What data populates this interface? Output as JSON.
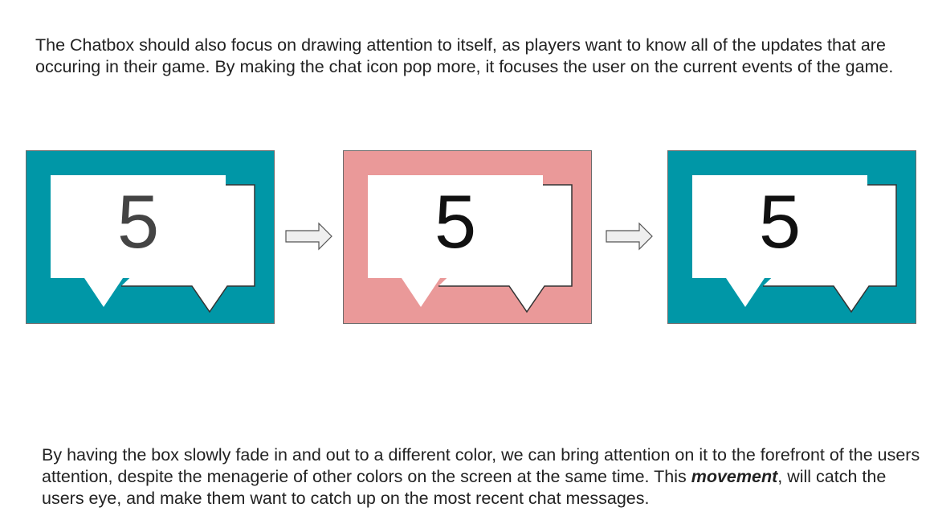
{
  "text": {
    "intro": "The Chatbox should also focus on drawing attention to itself, as players want to know all of the updates that are occuring in their game. By making the chat icon pop more, it focuses the user on the current events of the game.",
    "outro_before": "By having the box slowly fade in and out to a different color, we can bring attention on it to the forefront of the users attention, despite the menagerie of other colors on the screen at the same time. This ",
    "outro_emphasis": "movement",
    "outro_after": ", will catch the users eye, and make them want to catch up on the most recent chat messages."
  },
  "frames": [
    {
      "count": "5",
      "background": "#0097a7",
      "number_color": "#444444"
    },
    {
      "count": "5",
      "background": "#ea9999",
      "number_color": "#111111"
    },
    {
      "count": "5",
      "background": "#0097a7",
      "number_color": "#111111"
    }
  ],
  "icons": {
    "chat": "chat-bubble-icon",
    "arrow": "arrow-right-icon"
  },
  "colors": {
    "bubble": "#ffffff",
    "border": "#6b6b6b"
  }
}
